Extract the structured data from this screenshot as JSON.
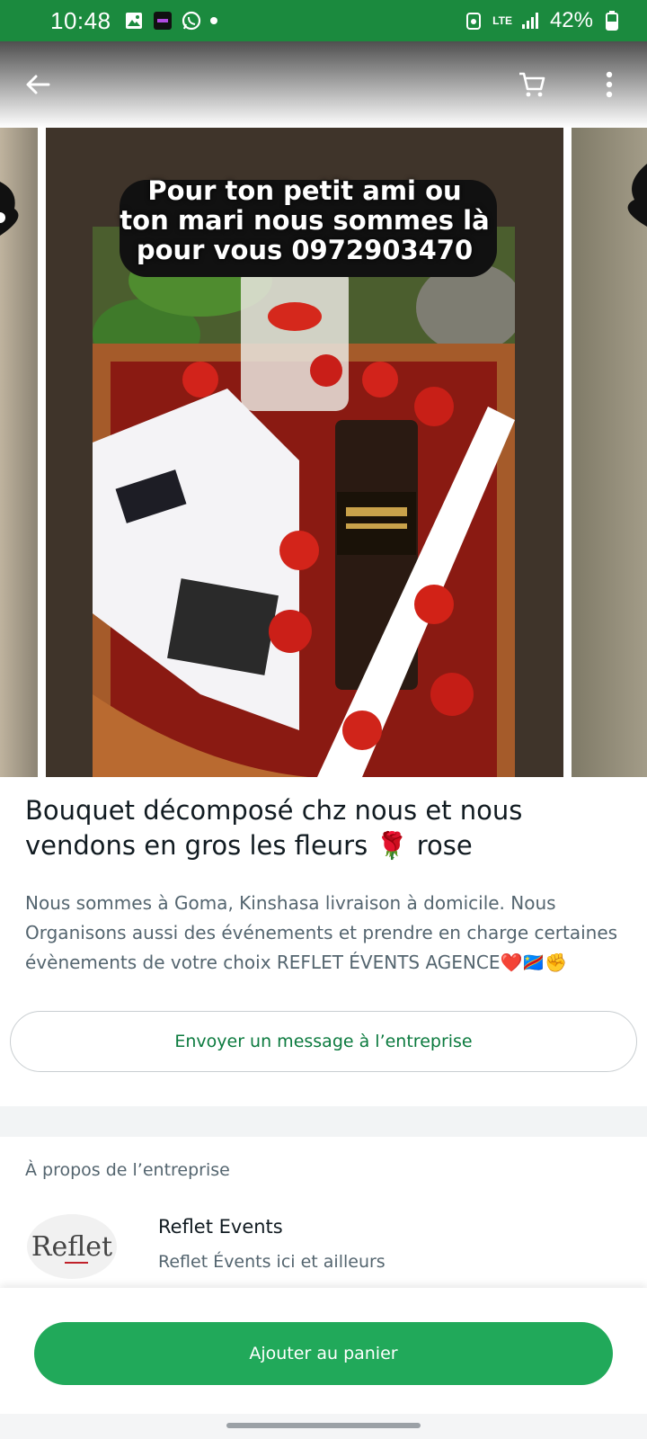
{
  "status_bar": {
    "time": "10:48",
    "network": "LTE",
    "battery": "42%"
  },
  "app_bar": {
    "back_icon": "arrow-left-icon",
    "cart_icon": "cart-icon",
    "menu_icon": "more-vertical-icon"
  },
  "hero": {
    "overlay_line1": "Pour ton petit ami ou",
    "overlay_line2": "ton mari nous sommes là",
    "overlay_line3": "pour vous 0972903470",
    "active_slide_fraction": 0.1
  },
  "product": {
    "title": "Bouquet décomposé chz nous et nous vendons en gros les fleurs 🌹 rose",
    "description": "Nous sommes à Goma, Kinshasa livraison à domicile. Nous Organisons aussi des événements et prendre en charge certaines évènements de votre choix REFLET ÉVENTS AGENCE❤️🇨🇩✊",
    "message_button": "Envoyer un message à l’entreprise"
  },
  "about": {
    "label": "À propos de l’entreprise",
    "logo_text": "Reflet",
    "business_name": "Reflet Events",
    "business_tagline": "Reflet Évents ici et ailleurs"
  },
  "bottom": {
    "add_to_cart": "Ajouter au panier"
  },
  "colors": {
    "status_bar": "#1b8a3e",
    "primary_button": "#21a95a",
    "link_text": "#0b7a3e"
  }
}
